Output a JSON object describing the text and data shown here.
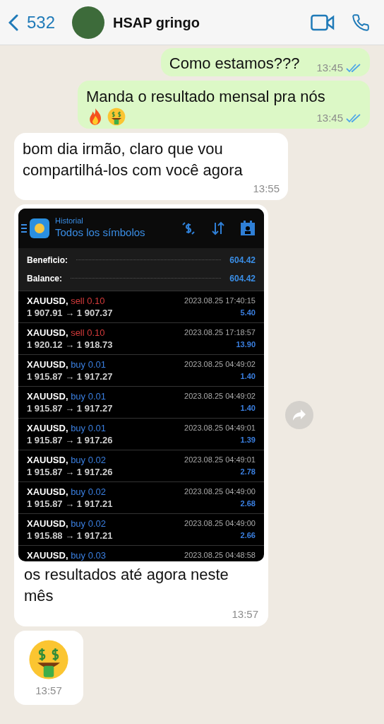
{
  "header": {
    "back_count": "532",
    "contact_name": "HSAP gringo"
  },
  "messages": [
    {
      "kind": "text",
      "outgoing": true,
      "text": "Como estamos???",
      "time": "13:45",
      "read": true
    },
    {
      "kind": "text",
      "outgoing": true,
      "text": "Manda o resultado mensal pra nós",
      "emojis": [
        {
          "kind": "fire"
        },
        {
          "kind": "money"
        }
      ],
      "time": "13:45",
      "read": true
    },
    {
      "kind": "text",
      "outgoing": false,
      "text": "bom dia irmão, claro que vou compartilhá-los com você agora",
      "time": "13:55"
    },
    {
      "kind": "image",
      "outgoing": false,
      "caption": "os resultados até agora neste mês",
      "time": "13:57",
      "screenshot": {
        "subtitle": "Historial",
        "title": "Todos los símbolos",
        "summary": [
          {
            "label": "Beneficio:",
            "value": "604.42"
          },
          {
            "label": "Balance:",
            "value": "604.42"
          }
        ],
        "trades": [
          {
            "symbol": "XAUUSD,",
            "color": "#d33a3a",
            "order": "sell 0.10",
            "prices": "1 907.91 → 1 907.37",
            "time": "2023.08.25 17:40:15",
            "profit": "5.40"
          },
          {
            "symbol": "XAUUSD,",
            "color": "#d33a3a",
            "order": "sell 0.10",
            "prices": "1 920.12 → 1 918.73",
            "time": "2023.08.25 17:18:57",
            "profit": "13.90"
          },
          {
            "symbol": "XAUUSD,",
            "color": "#3a7fe0",
            "order": "buy 0.01",
            "prices": "1 915.87 → 1 917.27",
            "time": "2023.08.25 04:49:02",
            "profit": "1.40"
          },
          {
            "symbol": "XAUUSD,",
            "color": "#3a7fe0",
            "order": "buy 0.01",
            "prices": "1 915.87 → 1 917.27",
            "time": "2023.08.25 04:49:02",
            "profit": "1.40"
          },
          {
            "symbol": "XAUUSD,",
            "color": "#3a7fe0",
            "order": "buy 0.01",
            "prices": "1 915.87 → 1 917.26",
            "time": "2023.08.25 04:49:01",
            "profit": "1.39"
          },
          {
            "symbol": "XAUUSD,",
            "color": "#3a7fe0",
            "order": "buy 0.02",
            "prices": "1 915.87 → 1 917.26",
            "time": "2023.08.25 04:49:01",
            "profit": "2.78"
          },
          {
            "symbol": "XAUUSD,",
            "color": "#3a7fe0",
            "order": "buy 0.02",
            "prices": "1 915.87 → 1 917.21",
            "time": "2023.08.25 04:49:00",
            "profit": "2.68"
          },
          {
            "symbol": "XAUUSD,",
            "color": "#3a7fe0",
            "order": "buy 0.02",
            "prices": "1 915.88 → 1 917.21",
            "time": "2023.08.25 04:49:00",
            "profit": "2.66"
          },
          {
            "symbol": "XAUUSD,",
            "color": "#3a7fe0",
            "order": "buy 0.03",
            "time": "2023.08.25 04:48:58"
          }
        ]
      }
    },
    {
      "kind": "emoji",
      "outgoing": false,
      "emojis": [
        {
          "kind": "money"
        }
      ],
      "time": "13:57"
    }
  ]
}
